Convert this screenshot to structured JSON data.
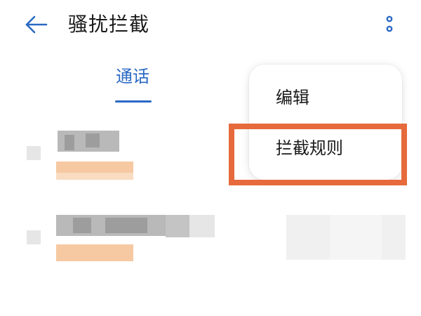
{
  "header": {
    "back_icon": "arrow-left-icon",
    "title": "骚扰拦截",
    "more_icon": "more-vertical-icon"
  },
  "tabs": [
    {
      "label": "通话",
      "active": true
    }
  ],
  "menu": {
    "items": [
      {
        "label": "编辑"
      },
      {
        "label": "拦截规则"
      }
    ]
  },
  "colors": {
    "accent": "#2a69c4",
    "highlight": "#e66a3c",
    "text": "#1a1a1a"
  }
}
